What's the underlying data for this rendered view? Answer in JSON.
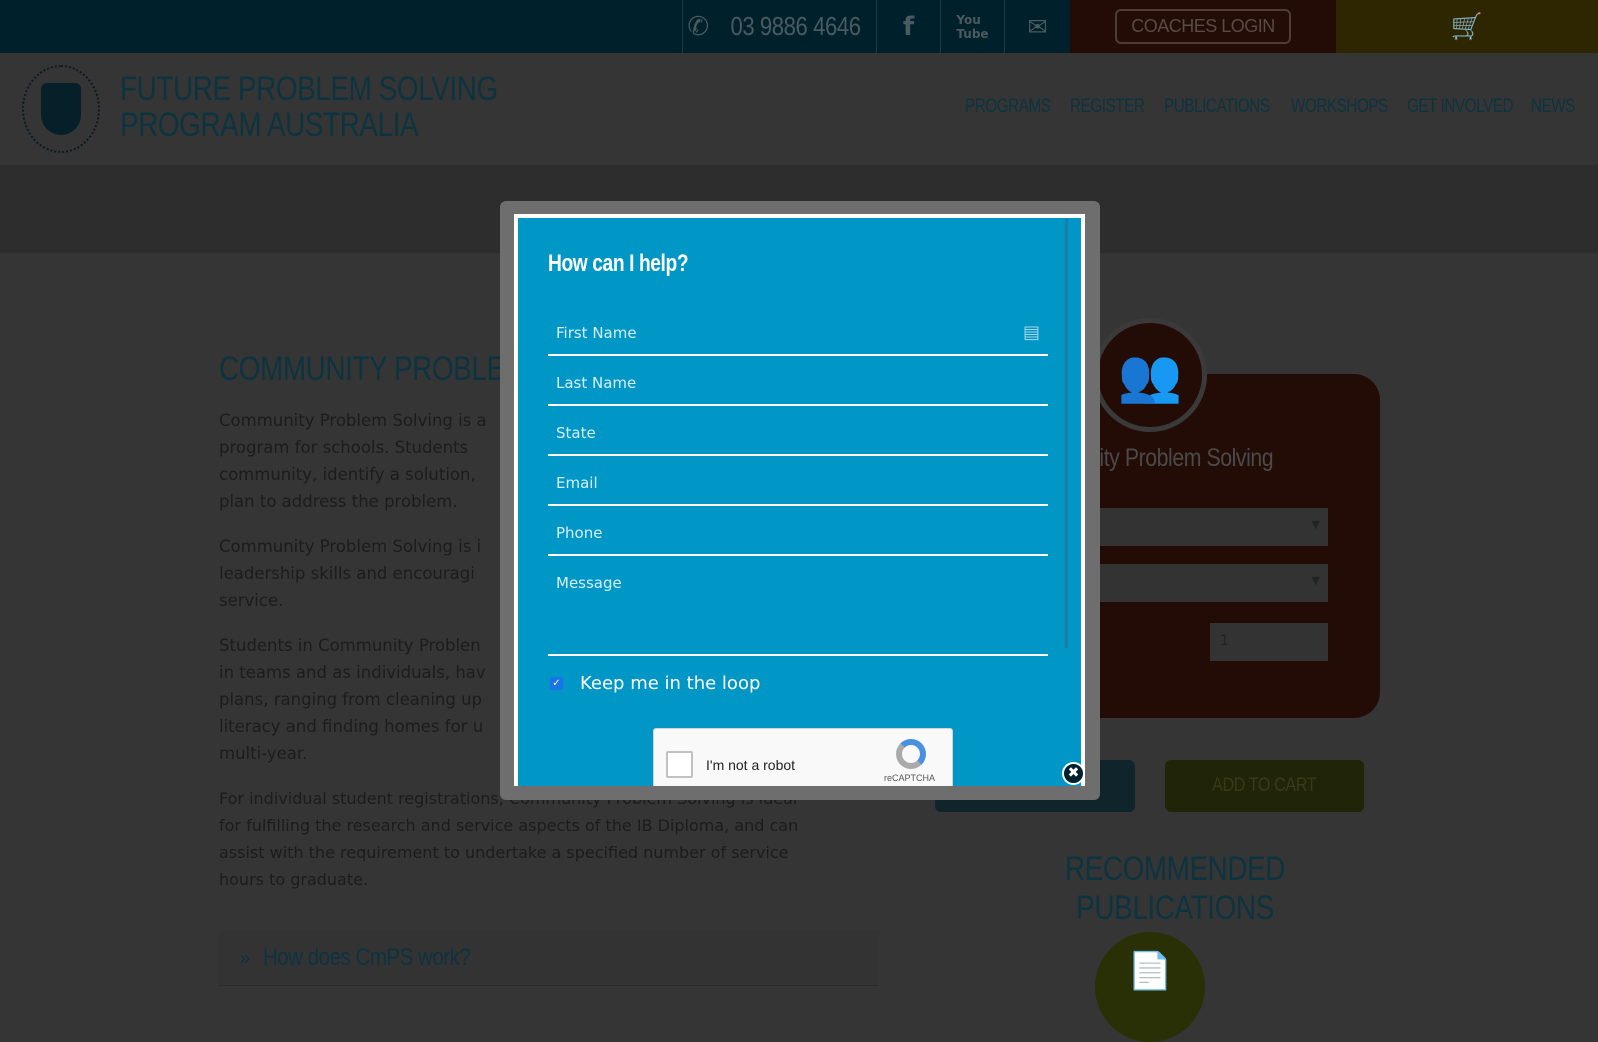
{
  "topbar": {
    "phone": "03 9886 4646",
    "coaches_login": "COACHES LOGIN",
    "icons": [
      "phone-icon",
      "facebook-icon",
      "youtube-icon",
      "mail-icon",
      "cart-icon"
    ]
  },
  "header": {
    "title_line1": "FUTURE PROBLEM SOLVING",
    "title_line2": "PROGRAM AUSTRALIA",
    "nav": [
      "PROGRAMS",
      "REGISTER",
      "PUBLICATIONS",
      "WORKSHOPS",
      "GET INVOLVED",
      "NEWS"
    ]
  },
  "content": {
    "title": "COMMUNITY PROBLEM S",
    "paragraphs": [
      [
        "Community Problem Solving is a",
        "program for schools.  Students",
        "community, identify a solution,",
        "plan to address the problem."
      ],
      [
        "Community Problem Solving is i",
        "leadership skills and encouragi",
        "service."
      ],
      [
        "Students in Community Problen",
        "in teams and as individuals, hav",
        "plans, ranging from cleaning up",
        "literacy and finding homes for u",
        "multi-year."
      ],
      [
        "For individual student registrations, Community Problem Solving is ideal",
        "for fulfilling the research and service aspects of the IB Diploma, and can",
        "assist with the requirement to undertake a specified number of service",
        "hours to graduate."
      ]
    ],
    "accordion": "How does CmPS work?"
  },
  "card": {
    "title": "nity Problem Solving",
    "quantity": "1",
    "add_to_cart": "ADD TO CART",
    "recommended": "RECOMMENDED PUBLICATIONS"
  },
  "modal": {
    "heading": "How can I help?",
    "placeholders": {
      "first_name": "First Name",
      "last_name": "Last Name",
      "state": "State",
      "email": "Email",
      "phone": "Phone",
      "message": "Message"
    },
    "checkbox_label": "Keep me in the loop",
    "checkbox_checked": true,
    "recaptcha_label": "I'm not a robot",
    "recaptcha_brand": "reCAPTCHA"
  },
  "colors": {
    "modal_blue": "#0096c6",
    "topbar": "#00202b",
    "login_section": "#220c05",
    "cart_section": "#2e2600"
  }
}
